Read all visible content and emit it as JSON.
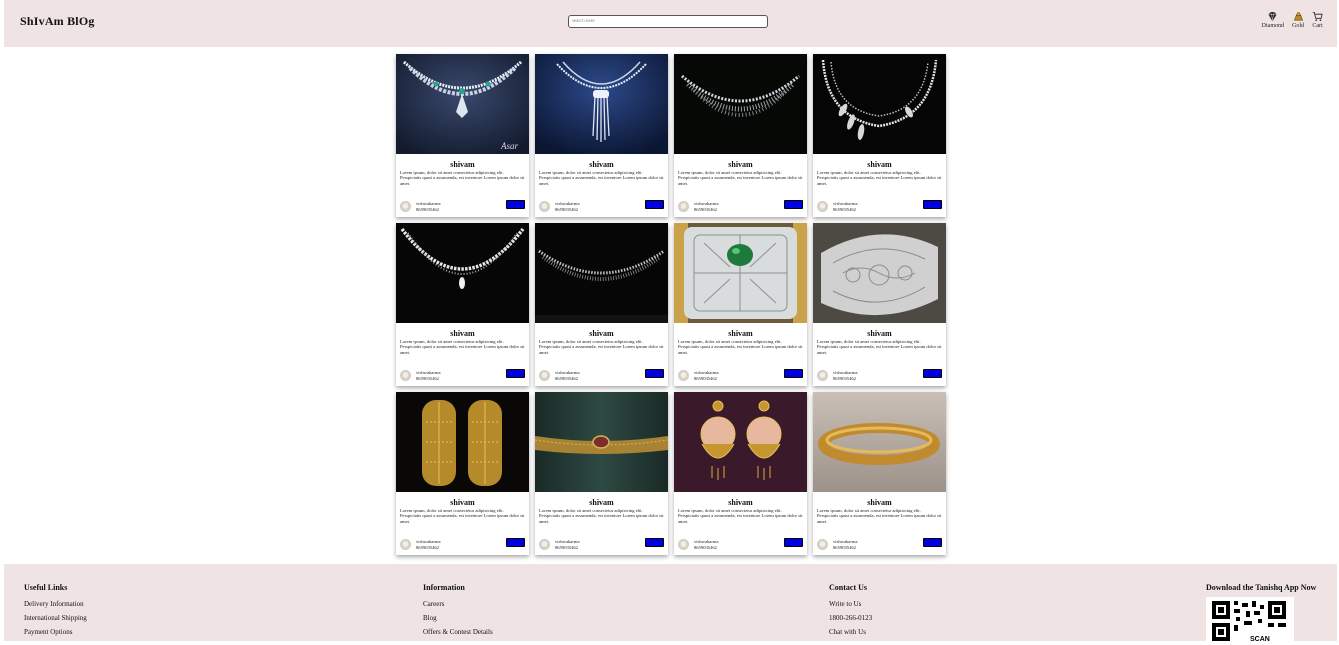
{
  "header": {
    "brand": "ShIvAm BlOg",
    "search_placeholder": "search here",
    "nav": [
      {
        "label": "Diamond",
        "icon": "diamond-icon"
      },
      {
        "label": "Gold",
        "icon": "gold-icon"
      },
      {
        "label": "Cart",
        "icon": "cart-icon"
      }
    ]
  },
  "colors": {
    "header_bg": "#efe3e3",
    "button": "#0000e0"
  },
  "cards": [
    {
      "title": "shivam",
      "text": "Lorem ipsum, dolor sit amet consectetur adipisicing elit. Perspiciatis quasi a assumenda, est inventore Lorem ipsum dolor sit amet.",
      "author": "vishwakarma",
      "phone": "8659035462",
      "image": "diamond-necklace-emerald"
    },
    {
      "title": "shivam",
      "text": "Lorem ipsum, dolor sit amet consectetur adipisicing elit. Perspiciatis quasi a assumenda, est inventore Lorem ipsum dolor sit amet.",
      "author": "vishwakarma",
      "phone": "8659035462",
      "image": "diamond-necklace-tassel"
    },
    {
      "title": "shivam",
      "text": "Lorem ipsum, dolor sit amet consectetur adipisicing elit. Perspiciatis quasi a assumenda, est inventore Lorem ipsum dolor sit amet.",
      "author": "vishwakarma",
      "phone": "8659035462",
      "image": "diamond-necklace-drop"
    },
    {
      "title": "shivam",
      "text": "Lorem ipsum, dolor sit amet consectetur adipisicing elit. Perspiciatis quasi a assumenda, est inventore Lorem ipsum dolor sit amet.",
      "author": "vishwakarma",
      "phone": "8659035462",
      "image": "diamond-necklace-leaf"
    },
    {
      "title": "shivam",
      "text": "Lorem ipsum, dolor sit amet consectetur adipisicing elit. Perspiciatis quasi a assumenda, est inventore Lorem ipsum dolor sit amet.",
      "author": "vishwakarma",
      "phone": "8659035462",
      "image": "diamond-necklace-marquise"
    },
    {
      "title": "shivam",
      "text": "Lorem ipsum, dolor sit amet consectetur adipisicing elit. Perspiciatis quasi a assumenda, est inventore Lorem ipsum dolor sit amet.",
      "author": "vishwakarma",
      "phone": "8659035462",
      "image": "diamond-necklace-collar"
    },
    {
      "title": "shivam",
      "text": "Lorem ipsum, dolor sit amet consectetur adipisicing elit. Perspiciatis quasi a assumenda, est inventore Lorem ipsum dolor sit amet.",
      "author": "vishwakarma",
      "phone": "8659035462",
      "image": "emerald-cuff"
    },
    {
      "title": "shivam",
      "text": "Lorem ipsum, dolor sit amet consectetur adipisicing elit. Perspiciatis quasi a assumenda, est inventore Lorem ipsum dolor sit amet.",
      "author": "vishwakarma",
      "phone": "8659035462",
      "image": "diamond-cuff"
    },
    {
      "title": "shivam",
      "text": "Lorem ipsum, dolor sit amet consectetur adipisicing elit. Perspiciatis quasi a assumenda, est inventore Lorem ipsum dolor sit amet.",
      "author": "vishwakarma",
      "phone": "8659035462",
      "image": "gold-bangles"
    },
    {
      "title": "shivam",
      "text": "Lorem ipsum, dolor sit amet consectetur adipisicing elit. Perspiciatis quasi a assumenda, est inventore Lorem ipsum dolor sit amet.",
      "author": "vishwakarma",
      "phone": "8659035462",
      "image": "gold-waist-belt"
    },
    {
      "title": "shivam",
      "text": "Lorem ipsum, dolor sit amet consectetur adipisicing elit. Perspiciatis quasi a assumenda, est inventore Lorem ipsum dolor sit amet.",
      "author": "vishwakarma",
      "phone": "8659035462",
      "image": "gold-earrings"
    },
    {
      "title": "shivam",
      "text": "Lorem ipsum, dolor sit amet consectetur adipisicing elit. Perspiciatis quasi a assumenda, est inventore Lorem ipsum dolor sit amet.",
      "author": "vishwakarma",
      "phone": "8659035462",
      "image": "gold-bangle"
    }
  ],
  "footer": {
    "useful_links": {
      "heading": "Useful Links",
      "links": [
        "Delivery Information",
        "International Shipping",
        "Payment Options"
      ]
    },
    "information": {
      "heading": "Information",
      "links": [
        "Careers",
        "Blog",
        "Offers & Contest Details"
      ]
    },
    "contact": {
      "heading": "Contact Us",
      "links": [
        "Write to Us",
        "1800-266-0123",
        "Chat with Us"
      ]
    },
    "app": {
      "heading": "Download the Tanishq App Now",
      "qr_label": "SCAN"
    }
  }
}
